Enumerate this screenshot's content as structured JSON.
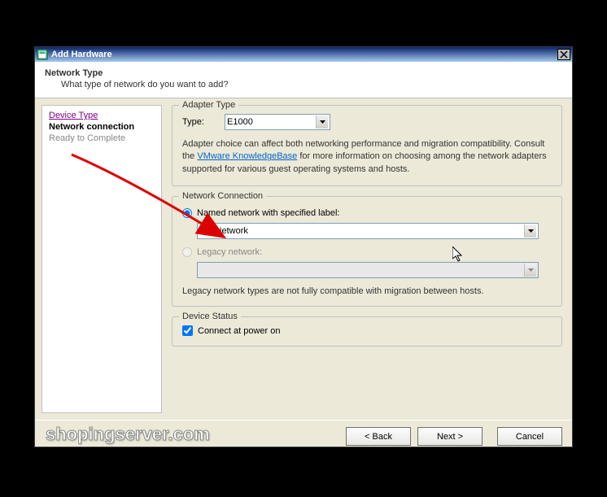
{
  "titlebar": {
    "title": "Add Hardware"
  },
  "header": {
    "main": "Network Type",
    "sub": "What type of network do you want to add?"
  },
  "sidebar": {
    "items": [
      {
        "label": "Device Type",
        "state": "visited"
      },
      {
        "label": "Network connection",
        "state": "current"
      },
      {
        "label": "Ready to Complete",
        "state": "disabled"
      }
    ]
  },
  "adapter": {
    "legend": "Adapter Type",
    "typeLabel": "Type:",
    "typeValue": "E1000",
    "desc1": "Adapter choice can affect both networking performance and migration compatibility. Consult the ",
    "kbLink": "VMware KnowledgeBase",
    "desc2": " for more information on choosing among the network adapters supported for various guest operating systems and hosts."
  },
  "network": {
    "legend": "Network Connection",
    "namedLabel": "Named network with specified label:",
    "namedValue": "VM Network",
    "legacyLabel": "Legacy network:",
    "legacyNote": "Legacy network types are not fully compatible with migration between hosts."
  },
  "device": {
    "legend": "Device Status",
    "connectLabel": "Connect at power on"
  },
  "footer": {
    "back": "< Back",
    "next": "Next >",
    "cancel": "Cancel"
  },
  "watermark": "shopingserver.com"
}
